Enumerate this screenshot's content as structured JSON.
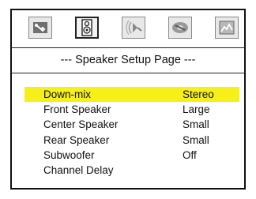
{
  "page": {
    "title": "--- Speaker Setup Page ---"
  },
  "tabs": [
    {
      "icon": "wrench-icon",
      "label": "",
      "selected": false
    },
    {
      "icon": "speaker-icon",
      "label": "",
      "selected": true
    },
    {
      "icon": "audio-waves-icon",
      "label": "",
      "selected": false
    },
    {
      "icon": "dolby-disc-icon",
      "label": "",
      "selected": false
    },
    {
      "icon": "preferences-icon",
      "label": "",
      "selected": false
    }
  ],
  "settings": [
    {
      "label": "Down-mix",
      "value": "Stereo",
      "highlighted": true
    },
    {
      "label": "Front Speaker",
      "value": "Large",
      "highlighted": false
    },
    {
      "label": "Center Speaker",
      "value": "Small",
      "highlighted": false
    },
    {
      "label": "Rear Speaker",
      "value": "Small",
      "highlighted": false
    },
    {
      "label": "Subwoofer",
      "value": "Off",
      "highlighted": false
    },
    {
      "label": "Channel Delay",
      "value": "",
      "highlighted": false
    }
  ],
  "colors": {
    "highlight": "#f7ef1a",
    "border": "#111111"
  }
}
